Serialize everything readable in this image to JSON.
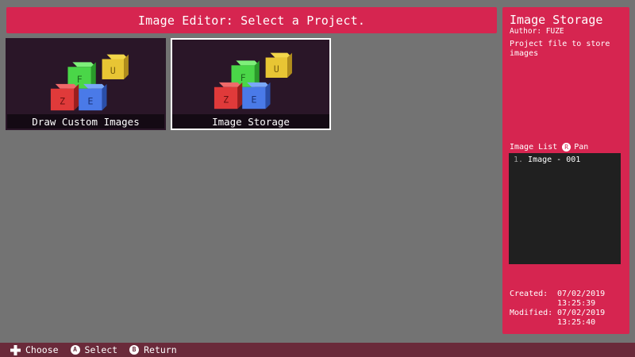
{
  "header": {
    "title": "Image Editor: Select a Project."
  },
  "projects": [
    {
      "label": "Draw Custom Images",
      "selected": false
    },
    {
      "label": "Image Storage",
      "selected": true
    }
  ],
  "side_panel": {
    "title": "Image Storage",
    "author": "Author: FUZE",
    "description": "Project file to store images",
    "list_heading": "Image List",
    "pan_button_glyph": "R",
    "pan_label": "Pan",
    "list_items": [
      {
        "number": "1.",
        "name": "Image - 001"
      }
    ],
    "created_label": "Created:",
    "created_date": "07/02/2019",
    "created_time": "13:25:39",
    "modified_label": "Modified:",
    "modified_date": "07/02/2019",
    "modified_time": "13:25:40"
  },
  "footer": {
    "choose_label": "Choose",
    "select_button": "A",
    "select_label": "Select",
    "return_button": "B",
    "return_label": "Return"
  },
  "colors": {
    "accent": "#d62550",
    "background": "#737373",
    "footer": "#6a2a3a",
    "card_bg": "#2a1628"
  },
  "icons": [
    "cubes-thumbnail-icon",
    "dpad-icon",
    "a-button-icon",
    "b-button-icon",
    "r-stick-icon"
  ]
}
